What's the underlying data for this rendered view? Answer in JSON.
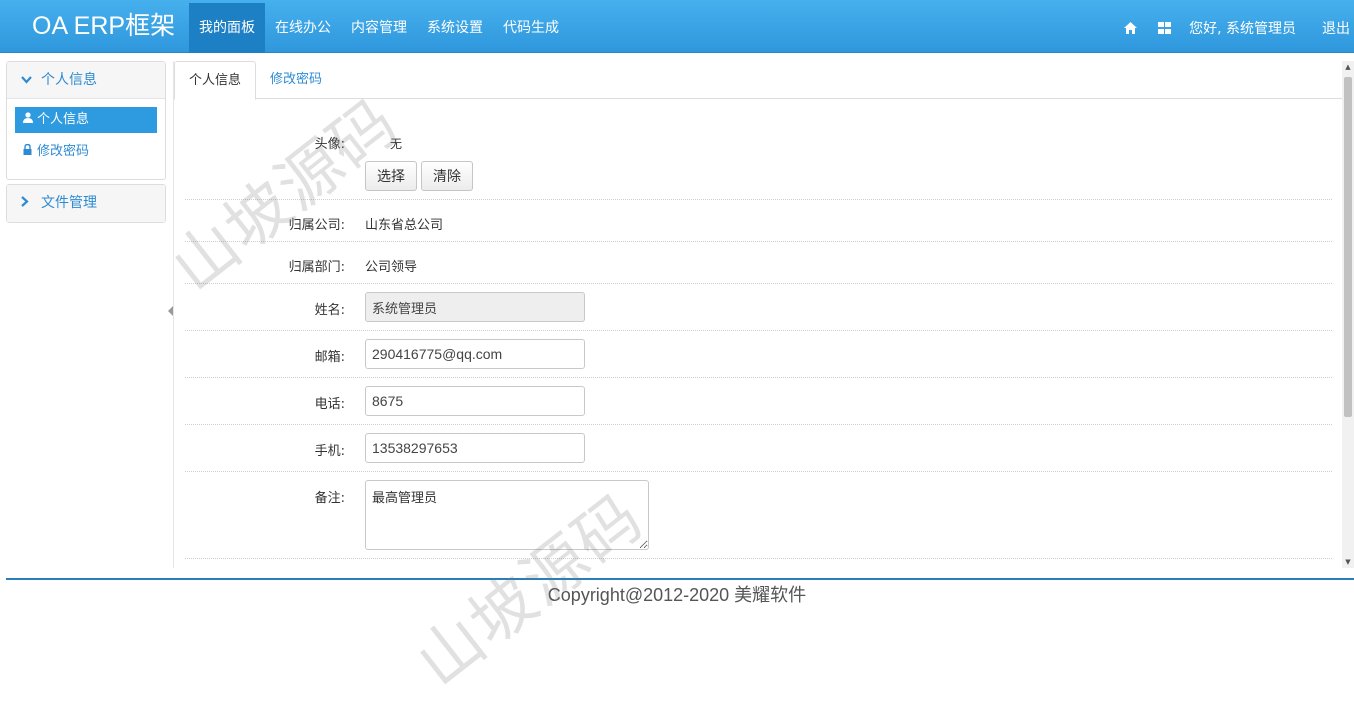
{
  "header": {
    "brand": "OA ERP框架",
    "nav": [
      "我的面板",
      "在线办公",
      "内容管理",
      "系统设置",
      "代码生成"
    ],
    "greeting": "您好, 系统管理员",
    "logout": "退出"
  },
  "sidebar": {
    "groups": [
      {
        "title": "个人信息",
        "items": [
          "个人信息",
          "修改密码"
        ]
      },
      {
        "title": "文件管理"
      }
    ]
  },
  "tabs": [
    "个人信息",
    "修改密码"
  ],
  "form": {
    "avatar_label": "头像:",
    "avatar_value": "无",
    "select_button": "选择",
    "clear_button": "清除",
    "company_label": "归属公司:",
    "company_value": "山东省总公司",
    "dept_label": "归属部门:",
    "dept_value": "公司领导",
    "name_label": "姓名:",
    "name_value": "系统管理员",
    "email_label": "邮箱:",
    "email_value": "290416775@qq.com",
    "phone_label": "电话:",
    "phone_value": "8675",
    "mobile_label": "手机:",
    "mobile_value": "13538297653",
    "remark_label": "备注:",
    "remark_value": "最高管理员"
  },
  "footer": "Copyright@2012-2020 美耀软件",
  "watermark": "山坡源码",
  "colors": {
    "navbar": "#3ba4e6",
    "nav_active": "#1d7fc4",
    "accent": "#2e8bd3"
  },
  "icons": {
    "home": "home-icon",
    "apps": "grid-icon",
    "user": "user-icon",
    "lock": "lock-icon"
  }
}
